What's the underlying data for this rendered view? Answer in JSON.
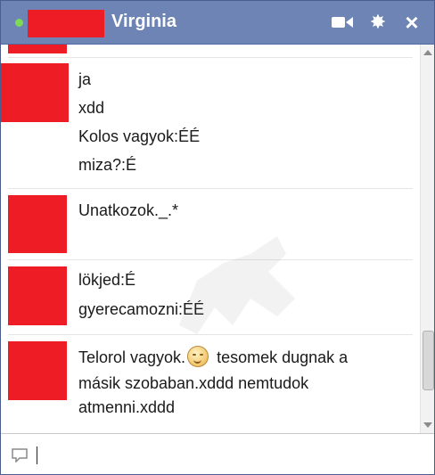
{
  "header": {
    "name": "Virginia",
    "status": "online",
    "icons": [
      "video-call-icon",
      "gear-icon",
      "close-icon"
    ]
  },
  "messages": [
    {
      "lines": [
        "ja",
        "xdd",
        "Kolos vagyok:ÉÉ",
        "miza?:É"
      ]
    },
    {
      "lines": [
        "Unatkozok._.*"
      ]
    },
    {
      "lines": [
        "lökjed:É",
        "gyerecamozni:ÉÉ"
      ]
    },
    {
      "lines": [
        {
          "before": "Telorol vagyok.",
          "emoticon": "smiley-icon",
          "after": " tesomek dugnak a"
        },
        "másik szobaban.xddd nemtudok",
        "atmenni.xddd"
      ]
    }
  ],
  "input": {
    "placeholder": "",
    "value": ""
  },
  "colors": {
    "titlebar": "#6d84b4",
    "online": "#7ed957",
    "redaction": "#ee1c25",
    "separator": "#e5e5e5"
  }
}
